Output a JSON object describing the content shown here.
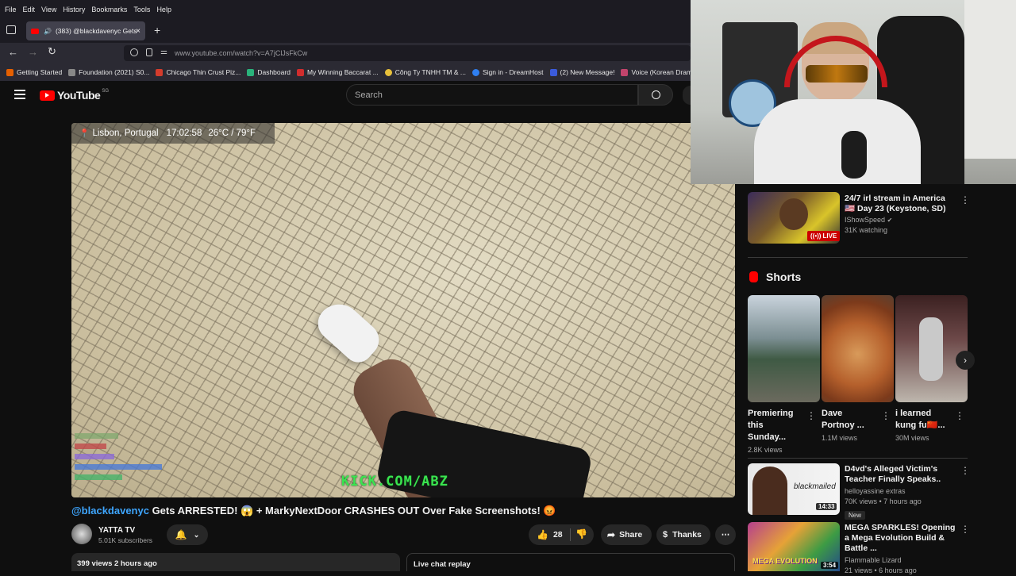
{
  "menu": [
    "File",
    "Edit",
    "View",
    "History",
    "Bookmarks",
    "Tools",
    "Help"
  ],
  "tab": {
    "title": "(383) @blackdavenyc Gets",
    "close": "×",
    "new_tab": "+"
  },
  "url": "www.youtube.com/watch?v=A7jClJsFkCw",
  "bookmarks": [
    {
      "label": "Getting Started",
      "color": "#e66000"
    },
    {
      "label": "Foundation (2021) S0...",
      "color": "#888888"
    },
    {
      "label": "Chicago Thin Crust Piz...",
      "color": "#d43c2c"
    },
    {
      "label": "Dashboard",
      "color": "#2ab27b"
    },
    {
      "label": "My Winning Baccarat ...",
      "color": "#d12d2d"
    },
    {
      "label": "Công Ty TNHH TM & ...",
      "color": "#e8c13b"
    },
    {
      "label": "Sign in - DreamHost",
      "color": "#2f7ff0"
    },
    {
      "label": "(2) New Message!",
      "color": "#3b5bdb"
    },
    {
      "label": "Voice (Korean Drama) ...",
      "color": "#c2446c"
    }
  ],
  "youtube": {
    "logo_text": "YouTube",
    "logo_badge": "SG",
    "search_placeholder": "Search"
  },
  "video": {
    "location": "Lisbon, Portugal",
    "time": "17:02:58",
    "weather": "26°C / 79°F",
    "watermark": "KICK.COM/ABZ",
    "title_mention": "@blackdavenyc",
    "title_rest": " Gets ARRESTED! 😱 + MarkyNextDoor CRASHES OUT Over Fake Screenshots! 😡",
    "channel": "YATTA TV",
    "subscribers": "5.01K subscribers",
    "likes": "28",
    "share": "Share",
    "thanks": "Thanks",
    "views_line": "399 views  2 hours ago",
    "live_chat": "Live chat replay"
  },
  "sidebar": {
    "top_video": {
      "title": "24/7 irl stream in America 🇺🇸 Day 23 (Keystone, SD)",
      "channel": "IShowSpeed",
      "meta": "31K watching",
      "badge": "LIVE"
    },
    "shorts_heading": "Shorts",
    "shorts": [
      {
        "title": "Premiering this Sunday...",
        "views": "2.8K views"
      },
      {
        "title": "Dave Portnoy ...",
        "views": "1.1M views"
      },
      {
        "title": "i learned kung fu🇨🇳...",
        "views": "30M views"
      }
    ],
    "videos": [
      {
        "title": "D4vd's Alleged Victim's Teacher Finally Speaks..",
        "channel": "helloyassine extras",
        "meta": "70K views • 7 hours ago",
        "tag": "New",
        "duration": "14:33",
        "thumb_text": "blackmailed"
      },
      {
        "title": "MEGA SPARKLES! Opening a Mega Evolution Build & Battle ...",
        "channel": "Flammable Lizard",
        "meta": "21 views • 6 hours ago",
        "duration": "3:54",
        "thumb_text": "MEGA EVOLUTION"
      }
    ]
  },
  "colors": {
    "accent": "#3ea6ff",
    "brand": "#ff0000",
    "live": "#cc0000"
  }
}
